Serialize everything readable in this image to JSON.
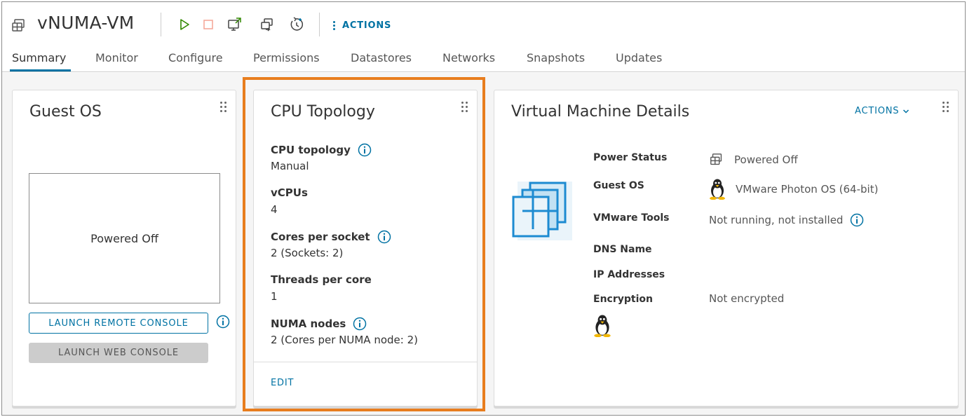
{
  "header": {
    "title": "vNUMA-VM",
    "actions_label": "ACTIONS"
  },
  "tabs": [
    {
      "label": "Summary",
      "active": true
    },
    {
      "label": "Monitor"
    },
    {
      "label": "Configure"
    },
    {
      "label": "Permissions"
    },
    {
      "label": "Datastores"
    },
    {
      "label": "Networks"
    },
    {
      "label": "Snapshots"
    },
    {
      "label": "Updates"
    }
  ],
  "guest_os_card": {
    "title": "Guest OS",
    "console_state": "Powered Off",
    "launch_remote_label": "LAUNCH REMOTE CONSOLE",
    "launch_web_label": "LAUNCH WEB CONSOLE"
  },
  "cpu_card": {
    "title": "CPU Topology",
    "fields": [
      {
        "label": "CPU topology",
        "value": "Manual",
        "info": true
      },
      {
        "label": "vCPUs",
        "value": "4",
        "info": false
      },
      {
        "label": "Cores per socket",
        "value": "2 (Sockets: 2)",
        "info": true
      },
      {
        "label": "Threads per core",
        "value": "1",
        "info": false
      },
      {
        "label": "NUMA nodes",
        "value": "2 (Cores per NUMA node: 2)",
        "info": true
      }
    ],
    "edit_label": "EDIT"
  },
  "vm_details_card": {
    "title": "Virtual Machine Details",
    "actions_label": "ACTIONS",
    "properties": [
      {
        "label": "Power Status",
        "value": "Powered Off",
        "icon": "vm-icon"
      },
      {
        "label": "Guest OS",
        "value": "VMware Photon OS (64-bit)",
        "icon": "linux-penguin-icon"
      },
      {
        "label": "VMware Tools",
        "value": "Not running, not installed",
        "icon": "info-icon"
      },
      {
        "label": "DNS Name",
        "value": ""
      },
      {
        "label": "IP Addresses",
        "value": ""
      },
      {
        "label": "Encryption",
        "value": "Not encrypted"
      }
    ]
  },
  "colors": {
    "accent": "#0072a3",
    "highlight": "#e87d1e",
    "play_green": "#318700",
    "stop_red": "#f5a99b"
  }
}
